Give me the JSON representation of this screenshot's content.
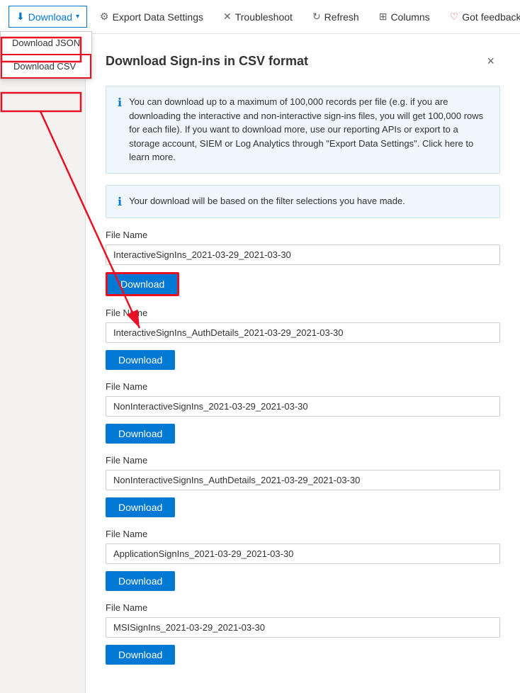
{
  "toolbar": {
    "download_label": "Download",
    "chevron": "▾",
    "export_label": "Export Data Settings",
    "troubleshoot_label": "Troubleshoot",
    "refresh_label": "Refresh",
    "columns_label": "Columns",
    "feedback_label": "Got feedback?"
  },
  "dropdown": {
    "items": [
      {
        "id": "json",
        "label": "Download JSON"
      },
      {
        "id": "csv",
        "label": "Download CSV",
        "active": true
      }
    ]
  },
  "modal": {
    "title": "Download Sign-ins in CSV format",
    "close_label": "×",
    "info1": "You can download up to a maximum of 100,000 records per file (e.g. if you are downloading the interactive and non-interactive sign-ins files, you will get 100,000 rows for each file). If you want to download more, use our reporting APIs or export to a storage account, SIEM or Log Analytics through \"Export Data Settings\". Click here to learn more.",
    "info2": "Your download will be based on the filter selections you have made.",
    "files": [
      {
        "label": "File Name",
        "filename": "InteractiveSignIns_2021-03-29_2021-03-30",
        "download_label": "Download",
        "highlighted": true
      },
      {
        "label": "File Name",
        "filename": "InteractiveSignIns_AuthDetails_2021-03-29_2021-03-30",
        "download_label": "Download",
        "highlighted": false
      },
      {
        "label": "File Name",
        "filename": "NonInteractiveSignIns_2021-03-29_2021-03-30",
        "download_label": "Download",
        "highlighted": false
      },
      {
        "label": "File Name",
        "filename": "NonInteractiveSignIns_AuthDetails_2021-03-29_2021-03-30",
        "download_label": "Download",
        "highlighted": false
      },
      {
        "label": "File Name",
        "filename": "ApplicationSignIns_2021-03-29_2021-03-30",
        "download_label": "Download",
        "highlighted": false
      },
      {
        "label": "File Name",
        "filename": "MSISignIns_2021-03-29_2021-03-30",
        "download_label": "Download",
        "highlighted": false
      }
    ]
  }
}
